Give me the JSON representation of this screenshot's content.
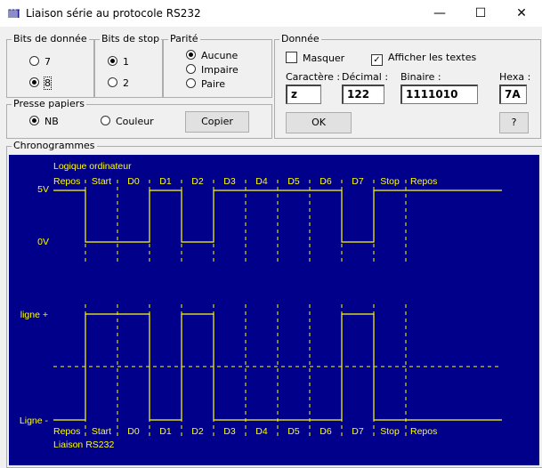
{
  "window": {
    "title": "Liaison série au protocole RS232",
    "minimize": "—",
    "maximize": "☐",
    "close": "✕"
  },
  "bits_donnee": {
    "label": "Bits de donnée",
    "options": [
      "7",
      "8"
    ],
    "selected": "8"
  },
  "bits_stop": {
    "label": "Bits de stop",
    "options": [
      "1",
      "2"
    ],
    "selected": "1"
  },
  "parite": {
    "label": "Parité",
    "options": [
      "Aucune",
      "Impaire",
      "Paire"
    ],
    "selected": "Aucune"
  },
  "donnee": {
    "label": "Donnée",
    "masquer": {
      "label": "Masquer",
      "checked": false
    },
    "afficher": {
      "label": "Afficher les textes",
      "checked": true
    },
    "caractere": {
      "label": "Caractère :",
      "value": "z"
    },
    "decimal": {
      "label": "Décimal :",
      "value": "122"
    },
    "binaire": {
      "label": "Binaire :",
      "value": "1111010"
    },
    "hexa": {
      "label": "Hexa :",
      "value": "7A"
    },
    "ok": "OK",
    "help": "?"
  },
  "presse_papiers": {
    "label": "Presse papiers",
    "options": [
      "NB",
      "Couleur"
    ],
    "selected": "NB",
    "copy": "Copier"
  },
  "chronogrammes": {
    "label": "Chronogrammes",
    "colors": {
      "background": "#00008b",
      "signal": "#ffff00"
    },
    "top_title": "Logique ordinateur",
    "bottom_title": "Liaison RS232",
    "top_high": "5V",
    "top_low": "0V",
    "bottom_high": "ligne +",
    "bottom_low": "Ligne -",
    "segments": [
      "Repos",
      "Start",
      "D0",
      "D1",
      "D2",
      "D3",
      "D4",
      "D5",
      "D6",
      "D7",
      "Stop",
      "Repos"
    ],
    "levels_logic": [
      1,
      0,
      0,
      1,
      0,
      1,
      1,
      1,
      1,
      0,
      1,
      1
    ],
    "levels_line": [
      0,
      1,
      1,
      0,
      1,
      0,
      0,
      0,
      0,
      1,
      0,
      0
    ]
  }
}
